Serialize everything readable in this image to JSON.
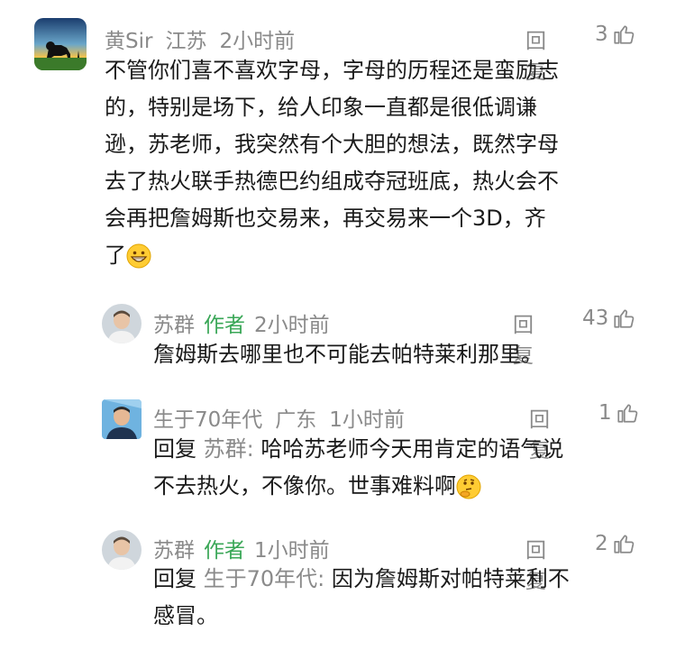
{
  "comments": [
    {
      "name": "黄Sir",
      "location": "江苏",
      "time": "2小时前",
      "reply_label": "回复",
      "likes": "3",
      "text_lines": [
        "不管你们喜不喜欢字母，字母的历程还是蛮励志",
        "的，特别是场下，给人印象一直都是很低调谦",
        "逊，苏老师，我突然有个大胆的想法，既然字母",
        "去了热火联手热德巴约组成夺冠班底，热火会不",
        "会再把詹姆斯也交易来，再交易来一个3D，齐",
        "了"
      ],
      "emoji": "grin-emoji"
    }
  ],
  "replies": [
    {
      "name": "苏群",
      "badge": "作者",
      "time": "2小时前",
      "reply_label": "回复",
      "likes": "43",
      "text_lines": [
        "詹姆斯去哪里也不可能去帕特莱利那里。"
      ]
    },
    {
      "name": "生于70年代",
      "location": "广东",
      "time": "1小时前",
      "reply_label": "回复",
      "likes": "1",
      "reply_prefix": "回复",
      "reply_to": "苏群:",
      "text_first": "哈哈苏老师今天用肯定的语气说",
      "text_lines": [
        "不去热火，不像你。世事难料啊"
      ],
      "emoji": "thinking-emoji"
    },
    {
      "name": "苏群",
      "badge": "作者",
      "time": "1小时前",
      "reply_label": "回复",
      "likes": "2",
      "reply_prefix": "回复",
      "reply_to": "生于70年代:",
      "text_first": "因为詹姆斯对帕特莱利不",
      "text_lines": [
        "感冒。"
      ]
    }
  ],
  "colors": {
    "author_badge": "#3aa757",
    "meta": "#8a8a8a",
    "text": "#1a1a1a"
  }
}
